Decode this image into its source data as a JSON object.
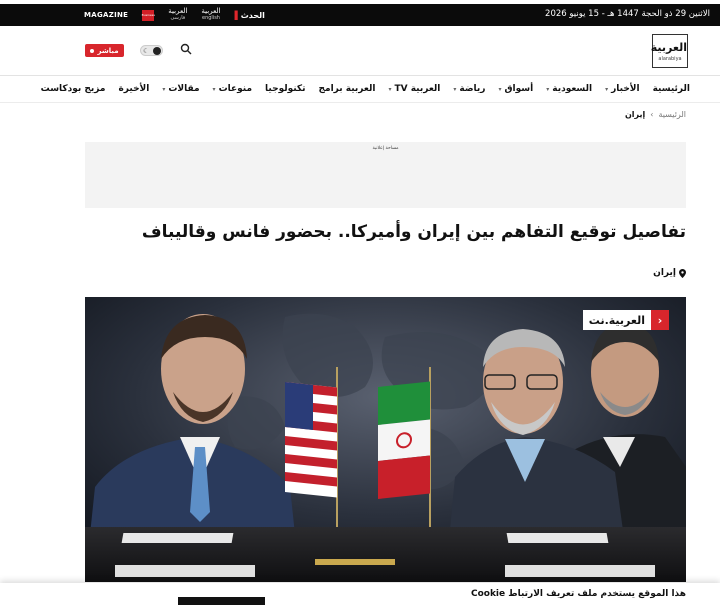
{
  "topbar": {
    "date": "الاثنين 29 ذو الحجة 1447 هـ - 15 يونيو 2026",
    "brands": [
      {
        "name": "magazine",
        "label": "MAGAZINE"
      },
      {
        "name": "business",
        "label": "Business"
      },
      {
        "name": "alarabiya-farsi",
        "label": "العربية",
        "sub": "فارسی"
      },
      {
        "name": "alarabiya-english",
        "label": "العربية",
        "sub": "english"
      },
      {
        "name": "alhadath",
        "label": "الحدث"
      }
    ]
  },
  "header": {
    "logo_ar": "العربية",
    "logo_en": "alarabiya",
    "live_label": "مباشر",
    "theme_icon": "moon-icon",
    "search_icon": "search-icon"
  },
  "nav": {
    "items": [
      {
        "label": "الرئيسية",
        "has_dropdown": false
      },
      {
        "label": "الأخبار",
        "has_dropdown": true
      },
      {
        "label": "السعودية",
        "has_dropdown": true
      },
      {
        "label": "أسواق",
        "has_dropdown": true
      },
      {
        "label": "رياضة",
        "has_dropdown": true
      },
      {
        "label": "العربية TV",
        "has_dropdown": true
      },
      {
        "label": "العربية برامج",
        "has_dropdown": false
      },
      {
        "label": "تكنولوجيا",
        "has_dropdown": false
      },
      {
        "label": "منوعات",
        "has_dropdown": true
      },
      {
        "label": "مقالات",
        "has_dropdown": true
      },
      {
        "label": "الأخيرة",
        "has_dropdown": false
      },
      {
        "label": "مزيج بودكاست",
        "has_dropdown": false
      }
    ]
  },
  "breadcrumb": {
    "home": "الرئيسية",
    "separator": "›",
    "current": "إيران"
  },
  "ad": {
    "label": "مساحة إعلانية"
  },
  "article": {
    "headline": "تفاصيل توقيع التفاهم بين إيران وأميركا.. بحضور فانس وقاليباف",
    "tag": "إيران",
    "watermark": "العربية.نت"
  },
  "cookie": {
    "text": "هذا الموقع يستخدم ملف تعريف الارتباط Cookie"
  },
  "colors": {
    "accent_red": "#d8262c",
    "topbar_bg": "#0b0b0b"
  }
}
